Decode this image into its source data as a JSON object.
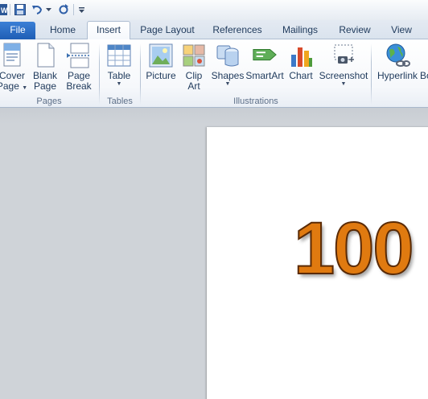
{
  "qat": {
    "icons": [
      "word-app-icon",
      "save-icon",
      "undo-icon",
      "undo-dropdown-icon",
      "redo-icon",
      "customize-qat-icon"
    ]
  },
  "tabs": {
    "file": "File",
    "home": "Home",
    "insert": "Insert",
    "page_layout": "Page Layout",
    "references": "References",
    "mailings": "Mailings",
    "review": "Review",
    "view": "View",
    "active": "Insert"
  },
  "ribbon": {
    "pages": {
      "label": "Pages",
      "cover_page_line1": "Cover",
      "cover_page_line2": "Page",
      "blank_page_line1": "Blank",
      "blank_page_line2": "Page",
      "page_break_line1": "Page",
      "page_break_line2": "Break"
    },
    "tables": {
      "label": "Tables",
      "table": "Table"
    },
    "illustrations": {
      "label": "Illustrations",
      "picture": "Picture",
      "clip_art_line1": "Clip",
      "clip_art_line2": "Art",
      "shapes": "Shapes",
      "smartart": "SmartArt",
      "chart": "Chart",
      "screenshot": "Screenshot"
    },
    "links": {
      "hyperlink": "Hyperlink",
      "bookmark_partial": "Bo"
    }
  },
  "document": {
    "content_text": "100",
    "text_color": "#e07a10"
  }
}
